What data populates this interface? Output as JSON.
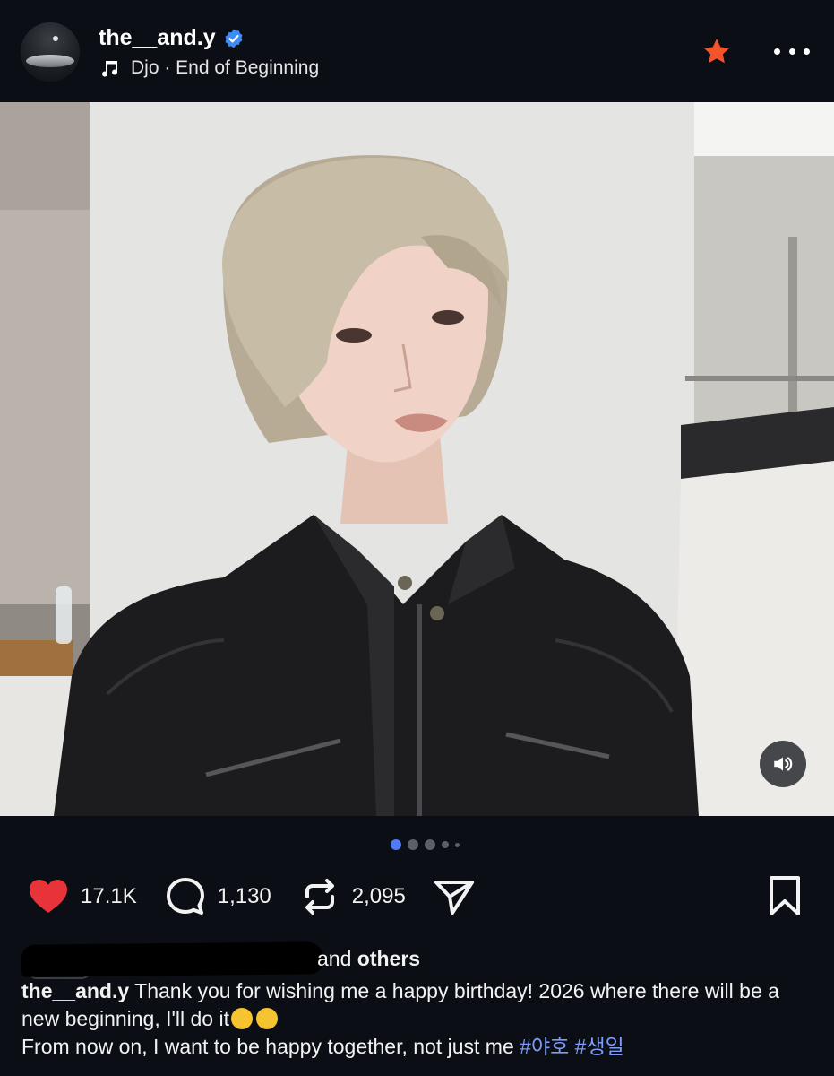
{
  "header": {
    "username": "the__and.y",
    "verified_icon": "verified-badge-icon",
    "music_icon": "music-note-icon",
    "music_text": "Djo · End of Beginning",
    "star_icon": "star-icon",
    "more_icon": "more-horizontal-icon"
  },
  "colors": {
    "background": "#0b0e14",
    "like": "#e8333a",
    "star": "#f2552c",
    "accent_blue": "#4f7cf6",
    "hashtag": "#7e9cf7"
  },
  "carousel": {
    "total": 5,
    "active_index": 0
  },
  "actions": {
    "like_count": "17.1K",
    "comment_count": "1,130",
    "repost_count": "2,095"
  },
  "liked_by": {
    "suffix_and": "and",
    "suffix_others": "others"
  },
  "caption": {
    "user": "the__and.y",
    "line1": "Thank you for wishing me a happy birthday! 2026 where there will be a new beginning, I'll do it",
    "emojis": [
      "smiling-face-emoji",
      "grinning-squinting-face-emoji"
    ],
    "line2": "From now on, I want to be happy together, not just me",
    "hashtags": [
      "#야호",
      "#생일"
    ]
  }
}
